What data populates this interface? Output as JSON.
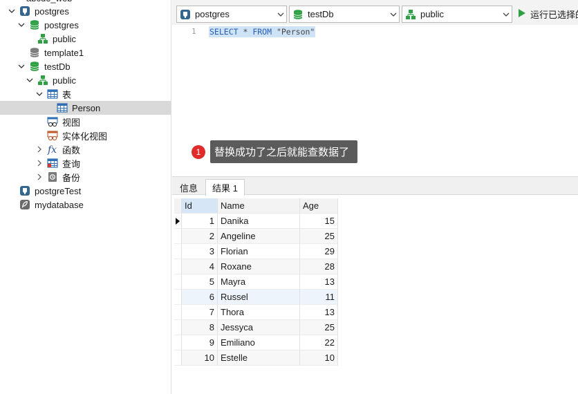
{
  "sidebar": {
    "clipped_item": "abcde_web",
    "items": [
      {
        "label": "postgres",
        "icon": "postgres-connection-icon",
        "level": 0,
        "expanded": true
      },
      {
        "label": "postgres",
        "icon": "database-green-icon",
        "level": 1,
        "expanded": true
      },
      {
        "label": "public",
        "icon": "schema-icon",
        "level": 2,
        "expanded": null
      },
      {
        "label": "template1",
        "icon": "database-gray-icon",
        "level": 1,
        "expanded": null
      },
      {
        "label": "testDb",
        "icon": "database-green-icon",
        "level": 1,
        "expanded": true
      },
      {
        "label": "public",
        "icon": "schema-icon",
        "level": 2,
        "expanded": true
      },
      {
        "label": "表",
        "icon": "table-icon",
        "level": 3,
        "expanded": true
      },
      {
        "label": "Person",
        "icon": "table-icon",
        "level": 4,
        "expanded": null,
        "selected": true
      },
      {
        "label": "视图",
        "icon": "view-icon",
        "level": 3,
        "expanded": null
      },
      {
        "label": "实体化视图",
        "icon": "materialized-view-icon",
        "level": 3,
        "expanded": null
      },
      {
        "label": "函数",
        "icon": "function-icon",
        "level": 3,
        "expanded": false
      },
      {
        "label": "查询",
        "icon": "query-icon",
        "level": 3,
        "expanded": false
      },
      {
        "label": "备份",
        "icon": "backup-icon",
        "level": 3,
        "expanded": false
      },
      {
        "label": "postgreTest",
        "icon": "postgres-connection-icon",
        "level": 0,
        "expanded": null
      },
      {
        "label": "mydatabase",
        "icon": "feather-connection-icon",
        "level": 0,
        "expanded": null
      }
    ]
  },
  "toolbar": {
    "connection": "postgres",
    "database": "testDb",
    "schema": "public",
    "run_label": "运行已选择的"
  },
  "editor": {
    "line_number": "1",
    "sql": {
      "k1": "SELECT",
      "star": " * ",
      "k2": "FROM",
      "table": " \"Person\""
    }
  },
  "callout": {
    "number": "1",
    "text": "替换成功了之后就能查数据了"
  },
  "result_tabs": [
    "信息",
    "结果 1"
  ],
  "grid": {
    "columns": [
      "Id",
      "Name",
      "Age"
    ],
    "rows": [
      [
        "1",
        "Danika",
        "15"
      ],
      [
        "2",
        "Angeline",
        "25"
      ],
      [
        "3",
        "Florian",
        "29"
      ],
      [
        "4",
        "Roxane",
        "28"
      ],
      [
        "5",
        "Mayra",
        "13"
      ],
      [
        "6",
        "Russel",
        "11"
      ],
      [
        "7",
        "Thora",
        "13"
      ],
      [
        "8",
        "Jessyca",
        "25"
      ],
      [
        "9",
        "Emiliano",
        "22"
      ],
      [
        "10",
        "Estelle",
        "10"
      ]
    ]
  },
  "colors": {
    "accent_green": "#2ea043",
    "postgres_blue": "#336791",
    "callout_red": "#e02b2b",
    "selection_gray": "#d9d9d9"
  }
}
